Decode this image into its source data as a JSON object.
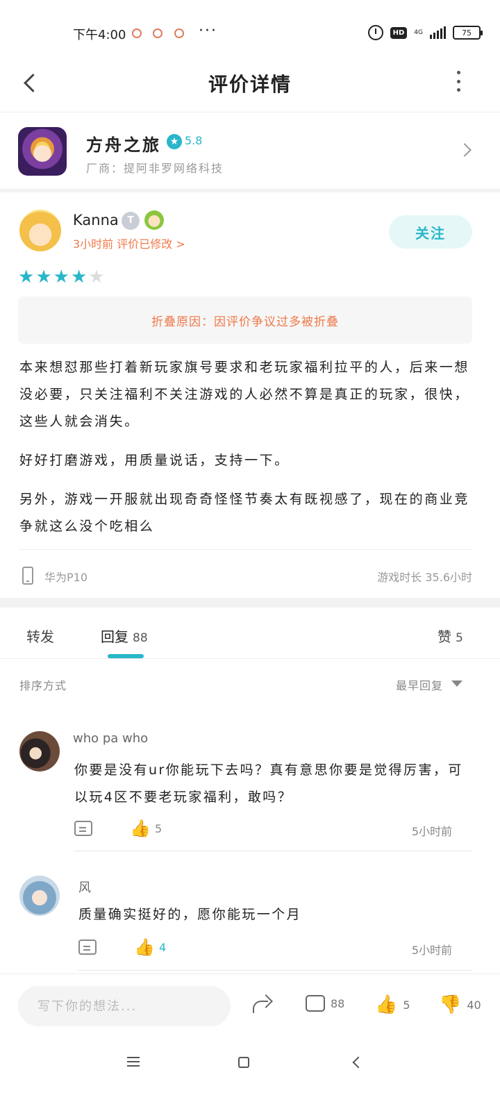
{
  "status_bar": {
    "time": "下午4:00",
    "more": "···",
    "network": "4G",
    "battery": "75",
    "hd": "HD"
  },
  "header": {
    "title": "评价详情"
  },
  "game": {
    "name": "方舟之旅",
    "score": "5.8",
    "vendor": "厂商：提阿非罗网络科技"
  },
  "review": {
    "author": "Kanna",
    "badge": "T",
    "meta": "3小时前 评价已修改 >",
    "follow_label": "关注",
    "rating": 4,
    "rating_max": 5,
    "fold_reason": "折叠原因：因评价争议过多被折叠",
    "paragraphs": [
      "本来想怼那些打着新玩家旗号要求和老玩家福利拉平的人，后来一想没必要，只关注福利不关注游戏的人必然不算是真正的玩家，很快，这些人就会消失。",
      "好好打磨游戏，用质量说话，支持一下。",
      "另外，游戏一开服就出现奇奇怪怪节奏太有既视感了，现在的商业竞争就这么没个吃相么"
    ],
    "device": "华为P10",
    "playtime": "游戏时长 35.6小时"
  },
  "tabs": {
    "forward": "转发",
    "reply": "回复",
    "reply_count": "88",
    "like": "赞",
    "like_count": "5"
  },
  "sort": {
    "label": "排序方式",
    "value": "最早回复"
  },
  "comments": [
    {
      "author": "who pa who",
      "text": "你要是没有ur你能玩下去吗？真有意思你要是觉得厉害，可以玩4区不要老玩家福利，敢吗？",
      "likes": "5",
      "liked": false,
      "time": "5小时前"
    },
    {
      "author": "风",
      "text": "质量确实挺好的，愿你能玩一个月",
      "likes": "4",
      "liked": true,
      "time": "5小时前"
    }
  ],
  "bottom_bar": {
    "input_placeholder": "写下你的想法...",
    "comment_count": "88",
    "like_count": "5",
    "dislike_count": "40"
  },
  "icons": {
    "star": "★",
    "thumb_up": "👍",
    "thumb_down": "👎"
  },
  "colors": {
    "accent": "#29b6c9",
    "warning": "#f0784a"
  }
}
